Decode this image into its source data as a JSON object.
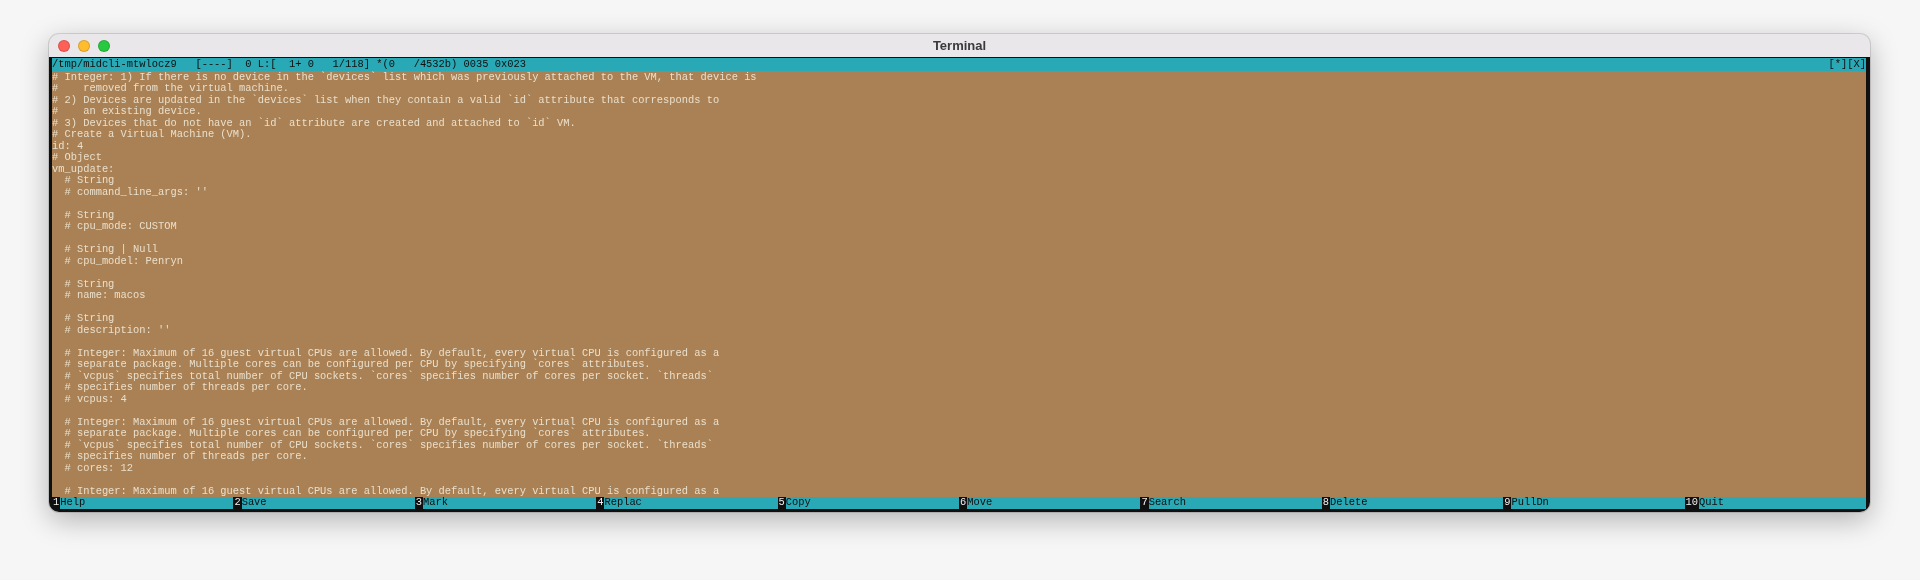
{
  "window": {
    "title": "Terminal"
  },
  "editor": {
    "status_line": "/tmp/midcli-mtwlocz9   [----]  0 L:[  1+ 0   1/118] *(0   /4532b) 0035 0x023",
    "status_flags": "[*][X]",
    "blocks": [
      [
        "# Integer: 1) If there is no device in the `devices` list which was previously attached to the VM, that device is",
        "#    removed from the virtual machine.",
        "# 2) Devices are updated in the `devices` list when they contain a valid `id` attribute that corresponds to",
        "#    an existing device.",
        "# 3) Devices that do not have an `id` attribute are created and attached to `id` VM.",
        "# Create a Virtual Machine (VM).",
        "id: 4",
        "# Object",
        "vm_update:",
        "  # String",
        "  # command_line_args: ''"
      ],
      [
        "  # String",
        "  # cpu_mode: CUSTOM"
      ],
      [
        "  # String | Null",
        "  # cpu_model: Penryn"
      ],
      [
        "  # String",
        "  # name: macos"
      ],
      [
        "  # String",
        "  # description: ''"
      ],
      [
        "  # Integer: Maximum of 16 guest virtual CPUs are allowed. By default, every virtual CPU is configured as a",
        "  # separate package. Multiple cores can be configured per CPU by specifying `cores` attributes.",
        "  # `vcpus` specifies total number of CPU sockets. `cores` specifies number of cores per socket. `threads`",
        "  # specifies number of threads per core.",
        "  # vcpus: 4"
      ],
      [
        "  # Integer: Maximum of 16 guest virtual CPUs are allowed. By default, every virtual CPU is configured as a",
        "  # separate package. Multiple cores can be configured per CPU by specifying `cores` attributes.",
        "  # `vcpus` specifies total number of CPU sockets. `cores` specifies number of cores per socket. `threads`",
        "  # specifies number of threads per core.",
        "  # cores: 12"
      ],
      [
        "  # Integer: Maximum of 16 guest virtual CPUs are allowed. By default, every virtual CPU is configured as a"
      ]
    ]
  },
  "function_keys": [
    {
      "key": "1",
      "label": "Help"
    },
    {
      "key": "2",
      "label": "Save"
    },
    {
      "key": "3",
      "label": "Mark"
    },
    {
      "key": "4",
      "label": "Replac"
    },
    {
      "key": "5",
      "label": "Copy"
    },
    {
      "key": "6",
      "label": "Move"
    },
    {
      "key": "7",
      "label": "Search"
    },
    {
      "key": "8",
      "label": "Delete"
    },
    {
      "key": "9",
      "label": "PullDn"
    },
    {
      "key": "10",
      "label": "Quit"
    }
  ]
}
